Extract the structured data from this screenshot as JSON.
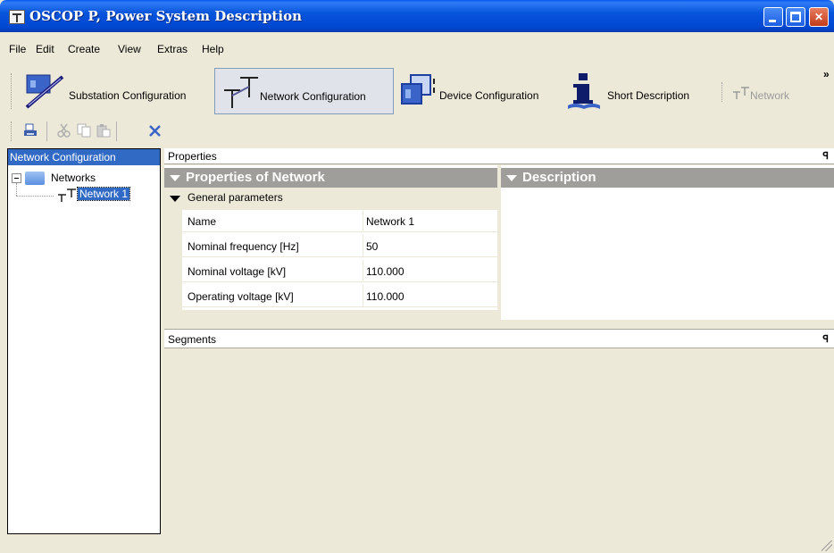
{
  "window": {
    "title": "OSCOP P, Power System Description"
  },
  "menu": {
    "items": [
      "File",
      "Edit",
      "Create",
      "View",
      "Extras",
      "Help"
    ]
  },
  "toolbar": {
    "buttons": [
      {
        "label": "Substation Configuration",
        "icon": "substation-icon"
      },
      {
        "label": "Network Configuration",
        "icon": "network-config-icon",
        "active": true
      },
      {
        "label": "Device Configuration",
        "icon": "device-config-icon"
      },
      {
        "label": "Short Description",
        "icon": "info-icon"
      },
      {
        "label": "Network",
        "icon": "network-icon",
        "disabled": true
      }
    ],
    "overflow": "»"
  },
  "tree": {
    "header": "Network Configuration",
    "root": "Networks",
    "child": "Network 1"
  },
  "properties": {
    "panel_title": "Properties",
    "section_title": "Properties of Network",
    "description_title": "Description",
    "group": "General parameters",
    "rows": [
      {
        "name": "Name",
        "value": "Network 1"
      },
      {
        "name": "Nominal frequency [Hz]",
        "value": "50"
      },
      {
        "name": "Nominal voltage [kV]",
        "value": "110.000"
      },
      {
        "name": "Operating voltage [kV]",
        "value": "110.000"
      }
    ]
  },
  "segments": {
    "panel_title": "Segments"
  },
  "colors": {
    "selection": "#316ac5",
    "titlebar": "#0855dd",
    "group_bar": "#a09e9a"
  }
}
